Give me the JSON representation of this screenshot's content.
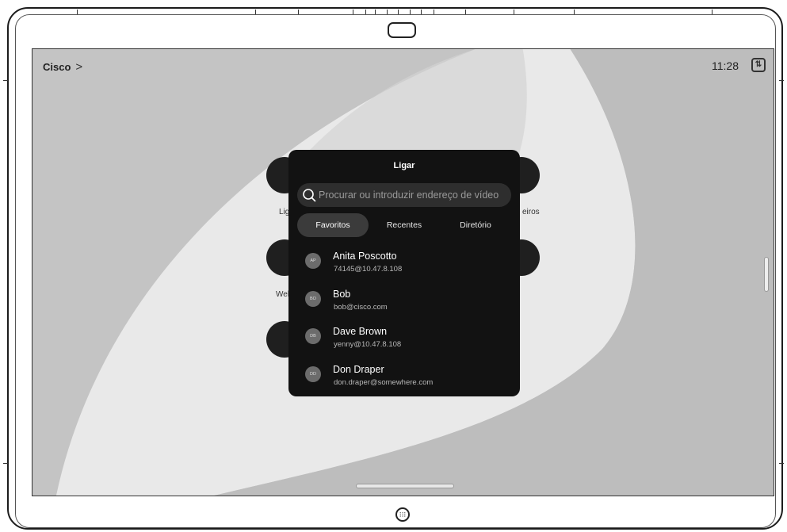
{
  "status_bar": {
    "brand": "Cisco",
    "brand_chevron": ">",
    "time": "11:28",
    "swap_icon": "swap-icon"
  },
  "home_buttons": [
    {
      "label": "Lig"
    },
    {
      "label": "eiros"
    },
    {
      "label": "Wel"
    }
  ],
  "dialog": {
    "title": "Ligar",
    "search_placeholder": "Procurar ou introduzir endereço de vídeo",
    "tabs": [
      {
        "label": "Favoritos",
        "active": true
      },
      {
        "label": "Recentes",
        "active": false
      },
      {
        "label": "Diretório",
        "active": false
      }
    ],
    "contacts": [
      {
        "initials": "AP",
        "name": "Anita Poscotto",
        "address": "74145@10.47.8.108"
      },
      {
        "initials": "BO",
        "name": "Bob",
        "address": "bob@cisco.com"
      },
      {
        "initials": "DB",
        "name": "Dave Brown",
        "address": "yenny@10.47.8.108"
      },
      {
        "initials": "DD",
        "name": "Don Draper",
        "address": "don.draper@somewhere.com"
      }
    ]
  },
  "colors": {
    "screen_bg": "#c6c6c6",
    "dialog_bg": "#121212",
    "active_tab": "#3b3b3b"
  }
}
